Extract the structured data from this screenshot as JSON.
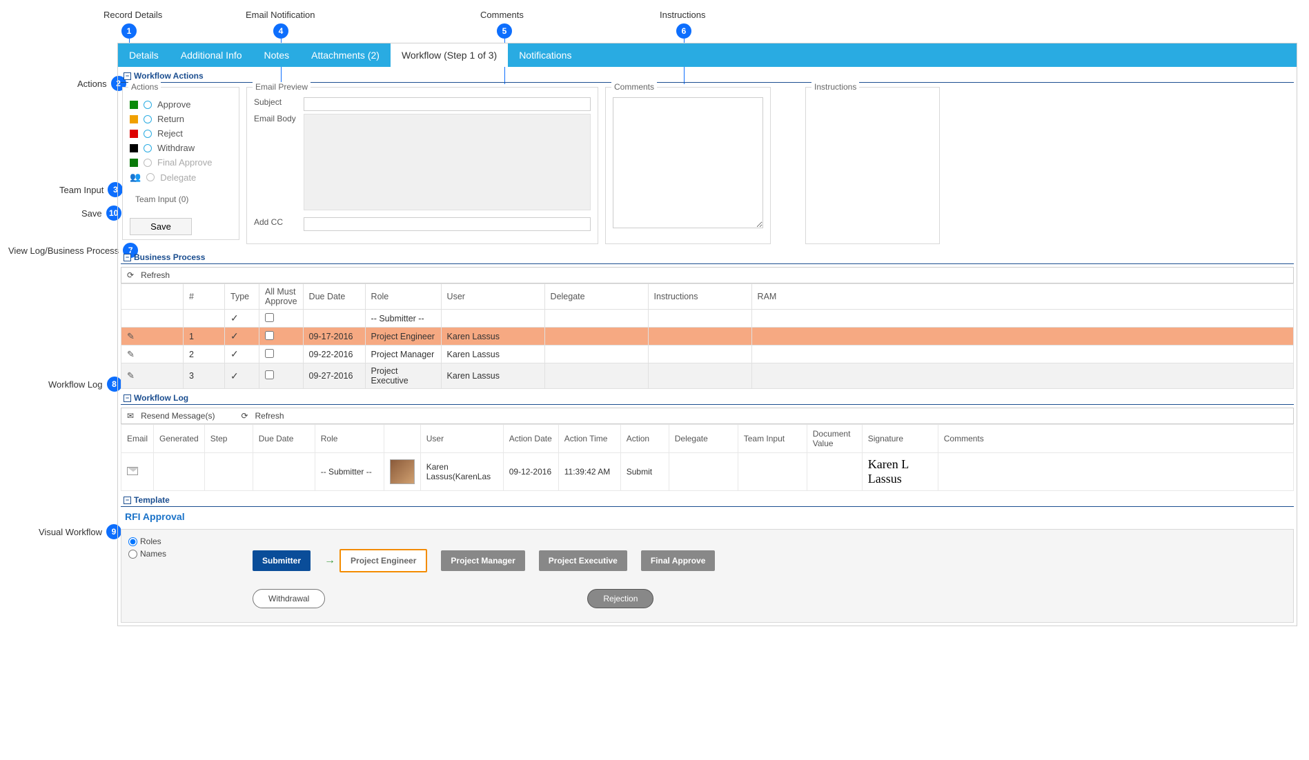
{
  "callouts": {
    "c1": "Record Details",
    "c2": "Actions",
    "c3": "Team Input",
    "c4": "Email Notification",
    "c5": "Comments",
    "c6": "Instructions",
    "c7": "View Log/Business Process",
    "c8": "Workflow Log",
    "c9": "Visual Workflow",
    "c10": "Save"
  },
  "tabs": {
    "details": "Details",
    "additional": "Additional Info",
    "notes": "Notes",
    "attachments": "Attachments (2)",
    "workflow": "Workflow (Step 1 of 3)",
    "notifications": "Notifications"
  },
  "sections": {
    "wf_actions": "Workflow Actions",
    "business_process": "Business Process",
    "workflow_log": "Workflow Log",
    "template": "Template"
  },
  "actions_box": {
    "title": "Actions",
    "approve": "Approve",
    "return": "Return",
    "reject": "Reject",
    "withdraw": "Withdraw",
    "final_approve": "Final Approve",
    "delegate": "Delegate",
    "team_input": "Team Input (0)",
    "save": "Save"
  },
  "email_box": {
    "title": "Email Preview",
    "subject_lbl": "Subject",
    "body_lbl": "Email Body",
    "addcc_lbl": "Add CC"
  },
  "comments_box": {
    "title": "Comments"
  },
  "instr_box": {
    "title": "Instructions"
  },
  "bp": {
    "refresh": "Refresh",
    "headers": {
      "num": "#",
      "type": "Type",
      "all_must": "All Must Approve",
      "due": "Due Date",
      "role": "Role",
      "user": "User",
      "delegate": "Delegate",
      "instructions": "Instructions",
      "ram": "RAM"
    },
    "rows": [
      {
        "num": "",
        "due": "",
        "role": "-- Submitter --",
        "user": ""
      },
      {
        "num": "1",
        "due": "09-17-2016",
        "role": "Project Engineer",
        "user": "Karen Lassus"
      },
      {
        "num": "2",
        "due": "09-22-2016",
        "role": "Project Manager",
        "user": "Karen Lassus"
      },
      {
        "num": "3",
        "due": "09-27-2016",
        "role": "Project Executive",
        "user": "Karen Lassus"
      }
    ]
  },
  "wl": {
    "resend": "Resend Message(s)",
    "refresh": "Refresh",
    "headers": {
      "email": "Email",
      "generated": "Generated",
      "step": "Step",
      "due": "Due Date",
      "role": "Role",
      "user": "User",
      "action_date": "Action Date",
      "action_time": "Action Time",
      "action": "Action",
      "delegate": "Delegate",
      "team_input": "Team Input",
      "doc_value": "Document Value",
      "signature": "Signature",
      "comments": "Comments"
    },
    "row": {
      "role": "-- Submitter --",
      "user": "Karen Lassus(KarenLas",
      "action_date": "09-12-2016",
      "action_time": "11:39:42 AM",
      "action": "Submit",
      "signature": "Karen L Lassus"
    }
  },
  "template": {
    "title": "RFI Approval",
    "roles": "Roles",
    "names": "Names",
    "nodes": {
      "submitter": "Submitter",
      "pe": "Project Engineer",
      "pm": "Project Manager",
      "px": "Project Executive",
      "fa": "Final Approve"
    },
    "withdrawal": "Withdrawal",
    "rejection": "Rejection"
  }
}
